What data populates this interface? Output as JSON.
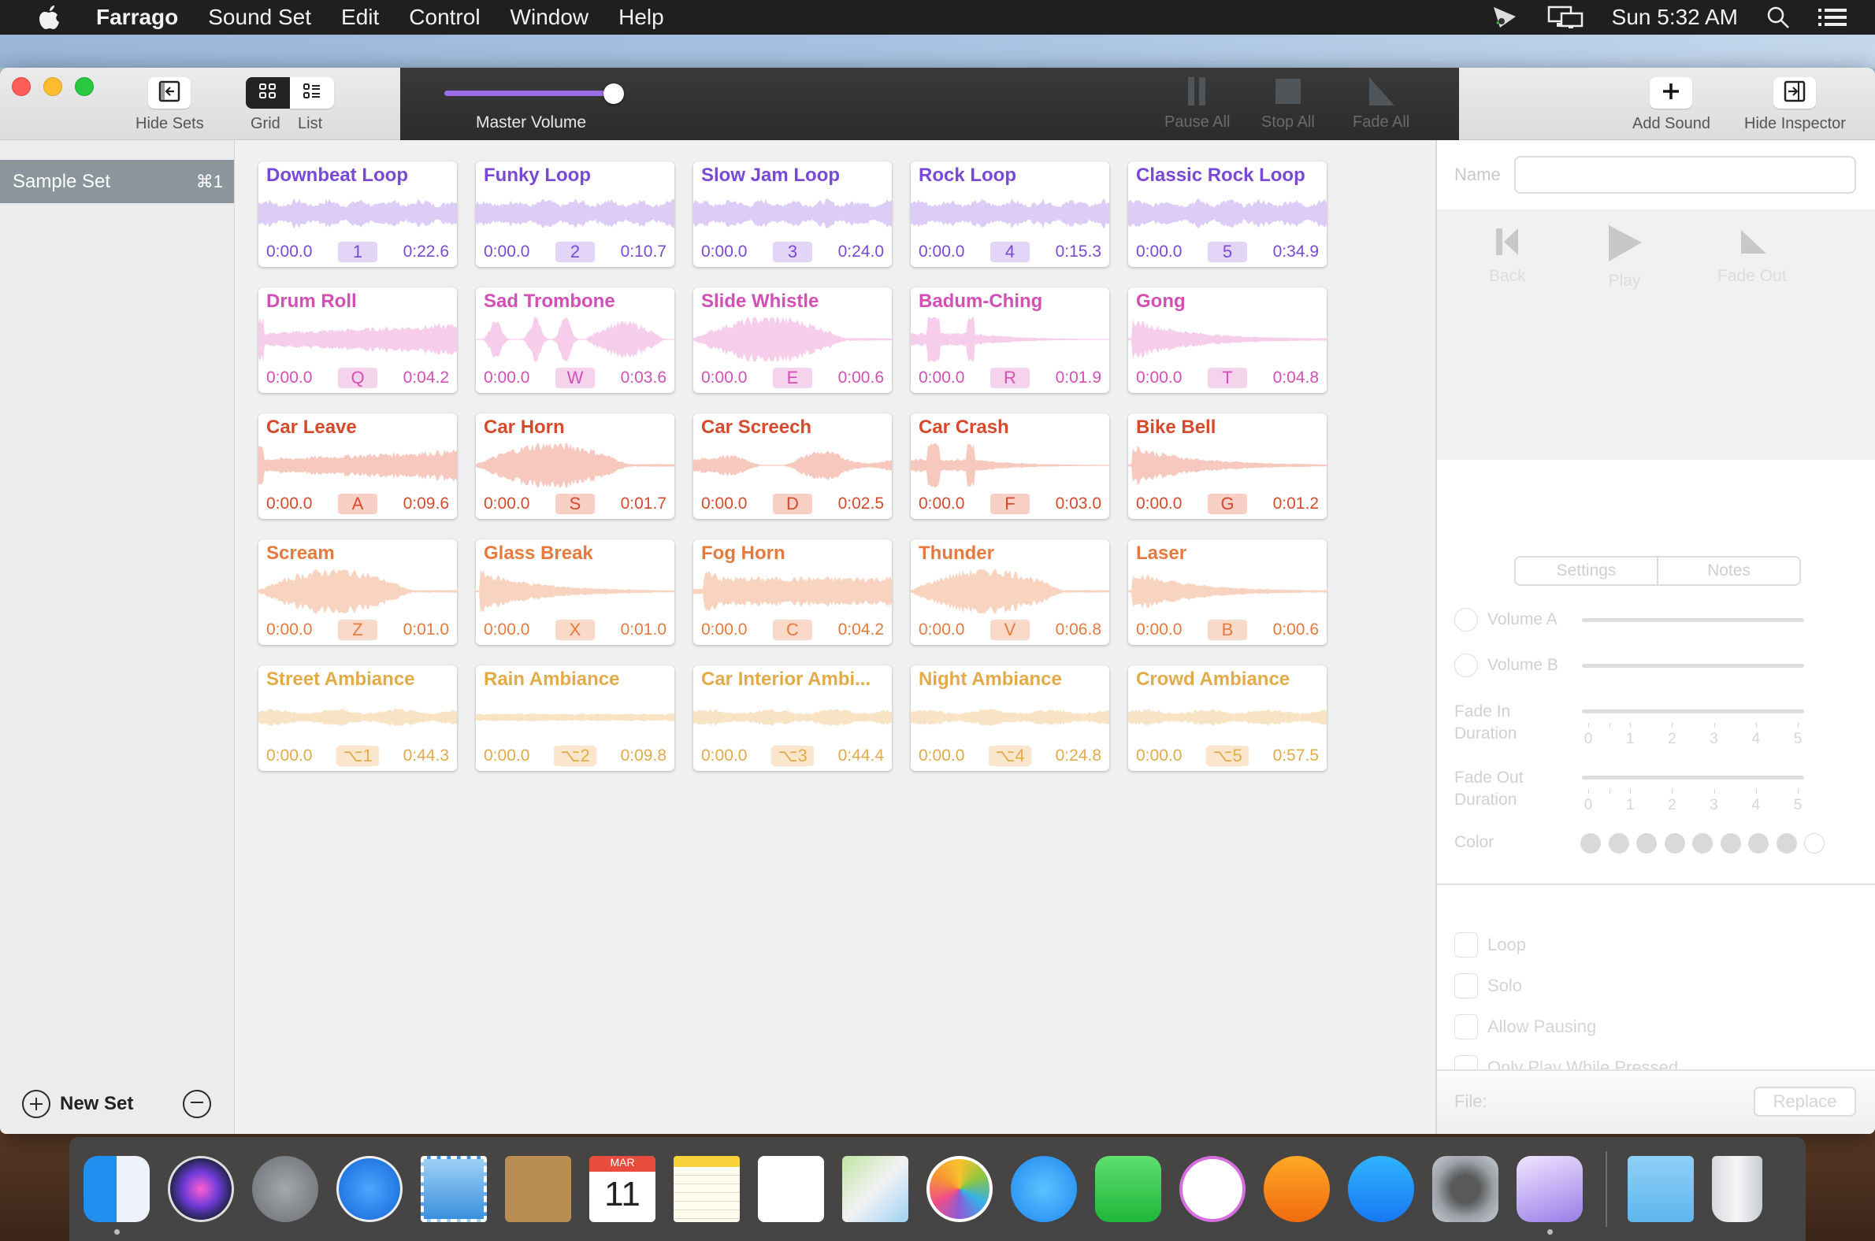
{
  "menubar": {
    "apple_icon": "apple-logo-icon",
    "app_name": "Farrago",
    "items": [
      "Sound Set",
      "Edit",
      "Control",
      "Window",
      "Help"
    ],
    "status_icons": [
      "presenter-icon",
      "display-mirroring-icon"
    ],
    "clock": "Sun 5:32 AM",
    "right_icons": [
      "spotlight-search-icon",
      "notification-center-icon"
    ]
  },
  "toolbar": {
    "hide_sets": "Hide Sets",
    "grid": "Grid",
    "list": "List",
    "view_mode": "Grid",
    "master_volume_label": "Master Volume",
    "master_volume_value": 1.0,
    "pause_all": "Pause All",
    "stop_all": "Stop All",
    "fade_all": "Fade All",
    "add_sound": "Add Sound",
    "hide_inspector": "Hide Inspector",
    "accent_color": "#9a6ce8"
  },
  "sidebar": {
    "sets": [
      {
        "name": "Sample Set",
        "shortcut": "⌘1",
        "selected": true
      }
    ],
    "new_set": "New Set"
  },
  "tile_colors": {
    "purple": {
      "text": "#7a48d6",
      "wave": "#dcccf6",
      "key_bg": "#e2d5f8"
    },
    "pink": {
      "text": "#d24fb5",
      "wave": "#f6cdea",
      "key_bg": "#f6d3ec"
    },
    "red": {
      "text": "#d64a2c",
      "wave": "#f7c8bd",
      "key_bg": "#f8d0c6"
    },
    "orange": {
      "text": "#e57a3e",
      "wave": "#f8d3c0",
      "key_bg": "#f9d9c8"
    },
    "yellow": {
      "text": "#e3ab48",
      "wave": "#f8e3c5",
      "key_bg": "#f9e6cc"
    }
  },
  "sounds": [
    {
      "title": "Downbeat Loop",
      "start": "0:00.0",
      "key": "1",
      "duration": "0:22.6",
      "color": "purple",
      "wave": "loop"
    },
    {
      "title": "Funky Loop",
      "start": "0:00.0",
      "key": "2",
      "duration": "0:10.7",
      "color": "purple",
      "wave": "loop"
    },
    {
      "title": "Slow Jam Loop",
      "start": "0:00.0",
      "key": "3",
      "duration": "0:24.0",
      "color": "purple",
      "wave": "loop"
    },
    {
      "title": "Rock Loop",
      "start": "0:00.0",
      "key": "4",
      "duration": "0:15.3",
      "color": "purple",
      "wave": "loop"
    },
    {
      "title": "Classic Rock Loop",
      "start": "0:00.0",
      "key": "5",
      "duration": "0:34.9",
      "color": "purple",
      "wave": "loop"
    },
    {
      "title": "Drum Roll",
      "start": "0:00.0",
      "key": "Q",
      "duration": "0:04.2",
      "color": "pink",
      "wave": "rise"
    },
    {
      "title": "Sad Trombone",
      "start": "0:00.0",
      "key": "W",
      "duration": "0:03.6",
      "color": "pink",
      "wave": "bursts"
    },
    {
      "title": "Slide Whistle",
      "start": "0:00.0",
      "key": "E",
      "duration": "0:00.6",
      "color": "pink",
      "wave": "hump"
    },
    {
      "title": "Badum-Ching",
      "start": "0:00.0",
      "key": "R",
      "duration": "0:01.9",
      "color": "pink",
      "wave": "hits"
    },
    {
      "title": "Gong",
      "start": "0:00.0",
      "key": "T",
      "duration": "0:04.8",
      "color": "pink",
      "wave": "decay"
    },
    {
      "title": "Car Leave",
      "start": "0:00.0",
      "key": "A",
      "duration": "0:09.6",
      "color": "red",
      "wave": "rise"
    },
    {
      "title": "Car Horn",
      "start": "0:00.0",
      "key": "S",
      "duration": "0:01.7",
      "color": "red",
      "wave": "hump"
    },
    {
      "title": "Car Screech",
      "start": "0:00.0",
      "key": "D",
      "duration": "0:02.5",
      "color": "red",
      "wave": "noise"
    },
    {
      "title": "Car Crash",
      "start": "0:00.0",
      "key": "F",
      "duration": "0:03.0",
      "color": "red",
      "wave": "hits"
    },
    {
      "title": "Bike Bell",
      "start": "0:00.0",
      "key": "G",
      "duration": "0:01.2",
      "color": "red",
      "wave": "decay"
    },
    {
      "title": "Scream",
      "start": "0:00.0",
      "key": "Z",
      "duration": "0:01.0",
      "color": "orange",
      "wave": "hump"
    },
    {
      "title": "Glass Break",
      "start": "0:00.0",
      "key": "X",
      "duration": "0:01.0",
      "color": "orange",
      "wave": "decay"
    },
    {
      "title": "Fog Horn",
      "start": "0:00.0",
      "key": "C",
      "duration": "0:04.2",
      "color": "orange",
      "wave": "block"
    },
    {
      "title": "Thunder",
      "start": "0:00.0",
      "key": "V",
      "duration": "0:06.8",
      "color": "orange",
      "wave": "hump"
    },
    {
      "title": "Laser",
      "start": "0:00.0",
      "key": "B",
      "duration": "0:00.6",
      "color": "orange",
      "wave": "decay"
    },
    {
      "title": "Street Ambiance",
      "start": "0:00.0",
      "key": "⌥1",
      "duration": "0:44.3",
      "color": "yellow",
      "wave": "ambient"
    },
    {
      "title": "Rain Ambiance",
      "start": "0:00.0",
      "key": "⌥2",
      "duration": "0:09.8",
      "color": "yellow",
      "wave": "flat"
    },
    {
      "title": "Car Interior Ambi...",
      "start": "0:00.0",
      "key": "⌥3",
      "duration": "0:44.4",
      "color": "yellow",
      "wave": "ambient"
    },
    {
      "title": "Night Ambiance",
      "start": "0:00.0",
      "key": "⌥4",
      "duration": "0:24.8",
      "color": "yellow",
      "wave": "ambient"
    },
    {
      "title": "Crowd Ambiance",
      "start": "0:00.0",
      "key": "⌥5",
      "duration": "0:57.5",
      "color": "yellow",
      "wave": "ambient"
    }
  ],
  "inspector": {
    "name_label": "Name",
    "name_value": "",
    "back": "Back",
    "play": "Play",
    "fade_out": "Fade Out",
    "tabs": [
      "Settings",
      "Notes"
    ],
    "volume_a": "Volume A",
    "volume_b": "Volume B",
    "fade_in_line1": "Fade In",
    "fade_in_line2": "Duration",
    "fade_out_line1": "Fade Out",
    "fade_out_line2": "Duration",
    "tick_labels": [
      "0",
      "1",
      "2",
      "3",
      "4",
      "5"
    ],
    "color_label": "Color",
    "color_swatch_count": 9,
    "checkboxes": [
      {
        "label": "Loop",
        "checked": false
      },
      {
        "label": "Solo",
        "checked": false
      },
      {
        "label": "Allow Pausing",
        "checked": false
      },
      {
        "label": "Only Play While Pressed",
        "checked": false
      }
    ],
    "file_label": "File:",
    "replace": "Replace"
  },
  "dock": {
    "apps": [
      {
        "name": "finder-icon",
        "running": true
      },
      {
        "name": "siri-icon",
        "running": false
      },
      {
        "name": "launchpad-icon",
        "running": false
      },
      {
        "name": "safari-icon",
        "running": false
      },
      {
        "name": "mail-icon",
        "running": false
      },
      {
        "name": "contacts-icon",
        "running": false
      },
      {
        "name": "calendar-icon",
        "running": false,
        "month": "MAR",
        "day": "11"
      },
      {
        "name": "notes-icon",
        "running": false
      },
      {
        "name": "reminders-icon",
        "running": false
      },
      {
        "name": "maps-icon",
        "running": false
      },
      {
        "name": "photos-icon",
        "running": false
      },
      {
        "name": "messages-icon",
        "running": false
      },
      {
        "name": "facetime-icon",
        "running": false
      },
      {
        "name": "itunes-icon",
        "running": false
      },
      {
        "name": "books-icon",
        "running": false
      },
      {
        "name": "app-store-icon",
        "running": false
      },
      {
        "name": "system-preferences-icon",
        "running": false
      },
      {
        "name": "farrago-icon",
        "running": true
      }
    ],
    "stacks": [
      "downloads-folder-icon",
      "trash-icon"
    ]
  }
}
